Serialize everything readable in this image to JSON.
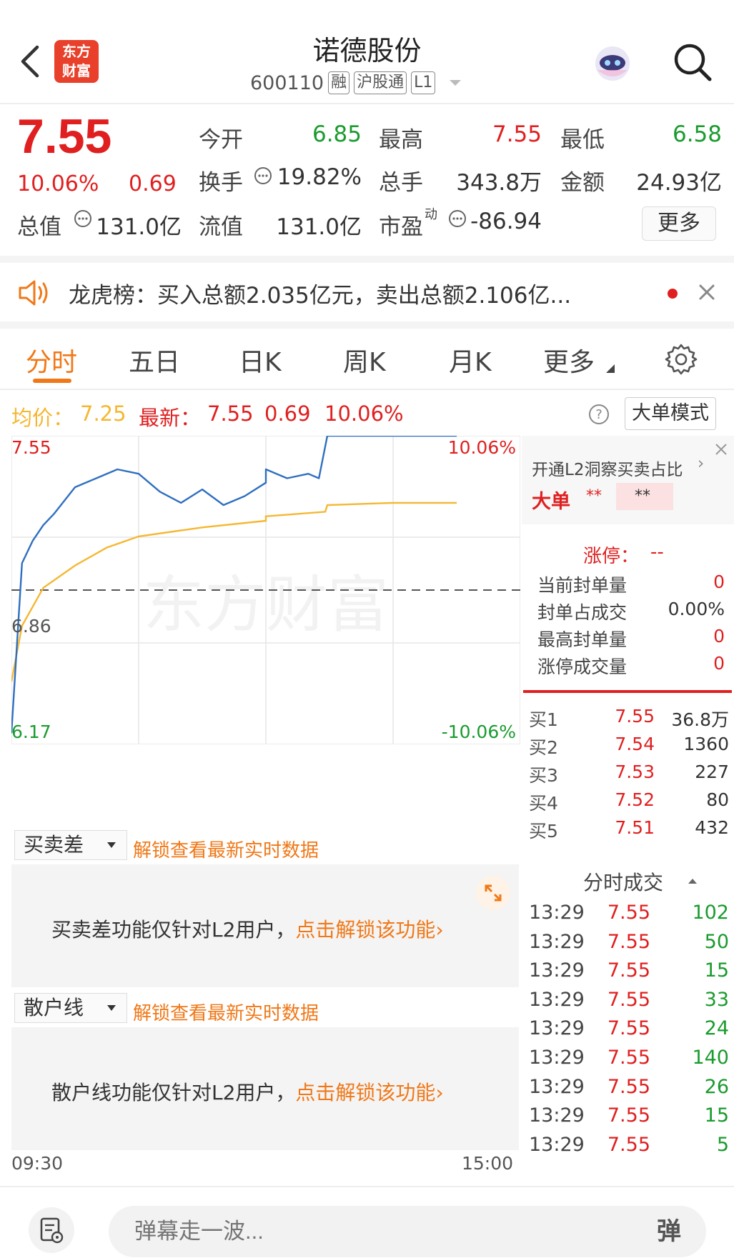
{
  "header": {
    "back_icon": "chevron-left-icon",
    "logo_text": [
      "东方",
      "财富"
    ],
    "title": "诺德股份",
    "code": "600110",
    "tags": [
      "融",
      "沪股通",
      "L1"
    ],
    "avatar_icon": "robot-avatar-icon",
    "search_icon": "search-icon"
  },
  "quote": {
    "price": "7.55",
    "change_pct": "10.06%",
    "change": "0.69",
    "open_label": "今开",
    "open": "6.85",
    "high_label": "最高",
    "high": "7.55",
    "low_label": "最低",
    "low": "6.58",
    "turnover_label": "换手",
    "turnover": "19.82%",
    "volume_label": "总手",
    "volume": "343.8万",
    "amount_label": "金额",
    "amount": "24.93亿",
    "mktcap_label": "总值",
    "mktcap": "131.0亿",
    "float_label": "流值",
    "float": "131.0亿",
    "pe_label": "市盈",
    "pe_sup": "动",
    "pe": "-86.94",
    "more_label": "更多"
  },
  "notice": {
    "icon": "speaker-icon",
    "text": "龙虎榜：买入总额2.035亿元，卖出总额2.106亿...",
    "close_icon": "close-icon"
  },
  "tabs": [
    "分时",
    "五日",
    "日K",
    "周K",
    "月K",
    "更多"
  ],
  "settings_icon": "gear-icon",
  "price_row": {
    "avg_label": "均价：",
    "avg": "7.25",
    "latest_label": "最新：",
    "latest": "7.55",
    "change": "0.69",
    "change_pct": "10.06%",
    "help_icon": "question-icon",
    "mode_label": "大单模式"
  },
  "chart": {
    "y_top": "7.55",
    "y_mid": "6.86",
    "y_bottom": "6.17",
    "pct_top": "10.06%",
    "pct_bottom": "-10.06%",
    "x_start": "09:30",
    "x_end": "15:00",
    "watermark": "东方财富",
    "colors": {
      "price_line": "#2f6fc0",
      "avg_line": "#f5b731"
    }
  },
  "chart_data": {
    "type": "line",
    "ylim": [
      6.17,
      7.55
    ],
    "xlim": [
      "09:30",
      "15:00"
    ],
    "prev_close": 6.86,
    "series": [
      {
        "name": "最新",
        "x": [
          "09:30",
          "09:35",
          "09:40",
          "09:45",
          "09:50",
          "09:55",
          "10:00",
          "10:10",
          "10:20",
          "10:30",
          "10:40",
          "10:50",
          "11:00",
          "11:10",
          "11:20",
          "11:30",
          "13:00",
          "13:10",
          "13:20",
          "13:25",
          "13:29",
          "14:00",
          "14:30"
        ],
        "values": [
          6.22,
          6.98,
          7.08,
          7.15,
          7.2,
          7.26,
          7.32,
          7.36,
          7.4,
          7.38,
          7.3,
          7.25,
          7.31,
          7.24,
          7.28,
          7.34,
          7.4,
          7.36,
          7.38,
          7.36,
          7.55,
          7.55,
          7.55
        ]
      },
      {
        "name": "均价",
        "x": [
          "09:30",
          "09:35",
          "09:45",
          "10:00",
          "10:15",
          "10:30",
          "11:00",
          "11:30",
          "13:00",
          "13:28",
          "13:29",
          "14:00",
          "14:30"
        ],
        "values": [
          6.45,
          6.7,
          6.87,
          6.97,
          7.05,
          7.1,
          7.14,
          7.17,
          7.19,
          7.21,
          7.24,
          7.25,
          7.25
        ]
      }
    ]
  },
  "side": {
    "l2_prompt": "开通L2洞察买卖占比",
    "big_order_label": "大单",
    "big_order_val": "**",
    "big_order_val2": "**",
    "limit_up_label": "涨停：",
    "limit_up_val": "--",
    "stats": [
      {
        "label": "当前封单量",
        "value": "0"
      },
      {
        "label": "封单占成交",
        "value": "0.00%"
      },
      {
        "label": "最高封单量",
        "value": "0"
      },
      {
        "label": "涨停成交量",
        "value": "0"
      }
    ],
    "bids": [
      {
        "label": "买1",
        "price": "7.55",
        "vol": "36.8万"
      },
      {
        "label": "买2",
        "price": "7.54",
        "vol": "1360"
      },
      {
        "label": "买3",
        "price": "7.53",
        "vol": "227"
      },
      {
        "label": "买4",
        "price": "7.52",
        "vol": "80"
      },
      {
        "label": "买5",
        "price": "7.51",
        "vol": "432"
      }
    ],
    "ticks_title": "分时成交",
    "ticks": [
      {
        "time": "13:29",
        "price": "7.55",
        "vol": "102"
      },
      {
        "time": "13:29",
        "price": "7.55",
        "vol": "50"
      },
      {
        "time": "13:29",
        "price": "7.55",
        "vol": "15"
      },
      {
        "time": "13:29",
        "price": "7.55",
        "vol": "33"
      },
      {
        "time": "13:29",
        "price": "7.55",
        "vol": "24"
      },
      {
        "time": "13:29",
        "price": "7.55",
        "vol": "140"
      },
      {
        "time": "13:29",
        "price": "7.55",
        "vol": "26"
      },
      {
        "time": "13:29",
        "price": "7.55",
        "vol": "15"
      },
      {
        "time": "13:29",
        "price": "7.55",
        "vol": "5"
      }
    ]
  },
  "panels": {
    "p1_select": "买卖差",
    "p1_unlock": "解锁查看最新实时数据",
    "p1_msg": "买卖差功能仅针对L2用户，",
    "p1_link": "点击解锁该功能",
    "p2_select": "散户线",
    "p2_unlock": "解锁查看最新实时数据",
    "p2_msg": "散户线功能仅针对L2用户，",
    "p2_link": "点击解锁该功能"
  },
  "bottom": {
    "menu_icon": "list-settings-icon",
    "danmu_placeholder": "弹幕走一波...",
    "danmu_button": "弹"
  }
}
